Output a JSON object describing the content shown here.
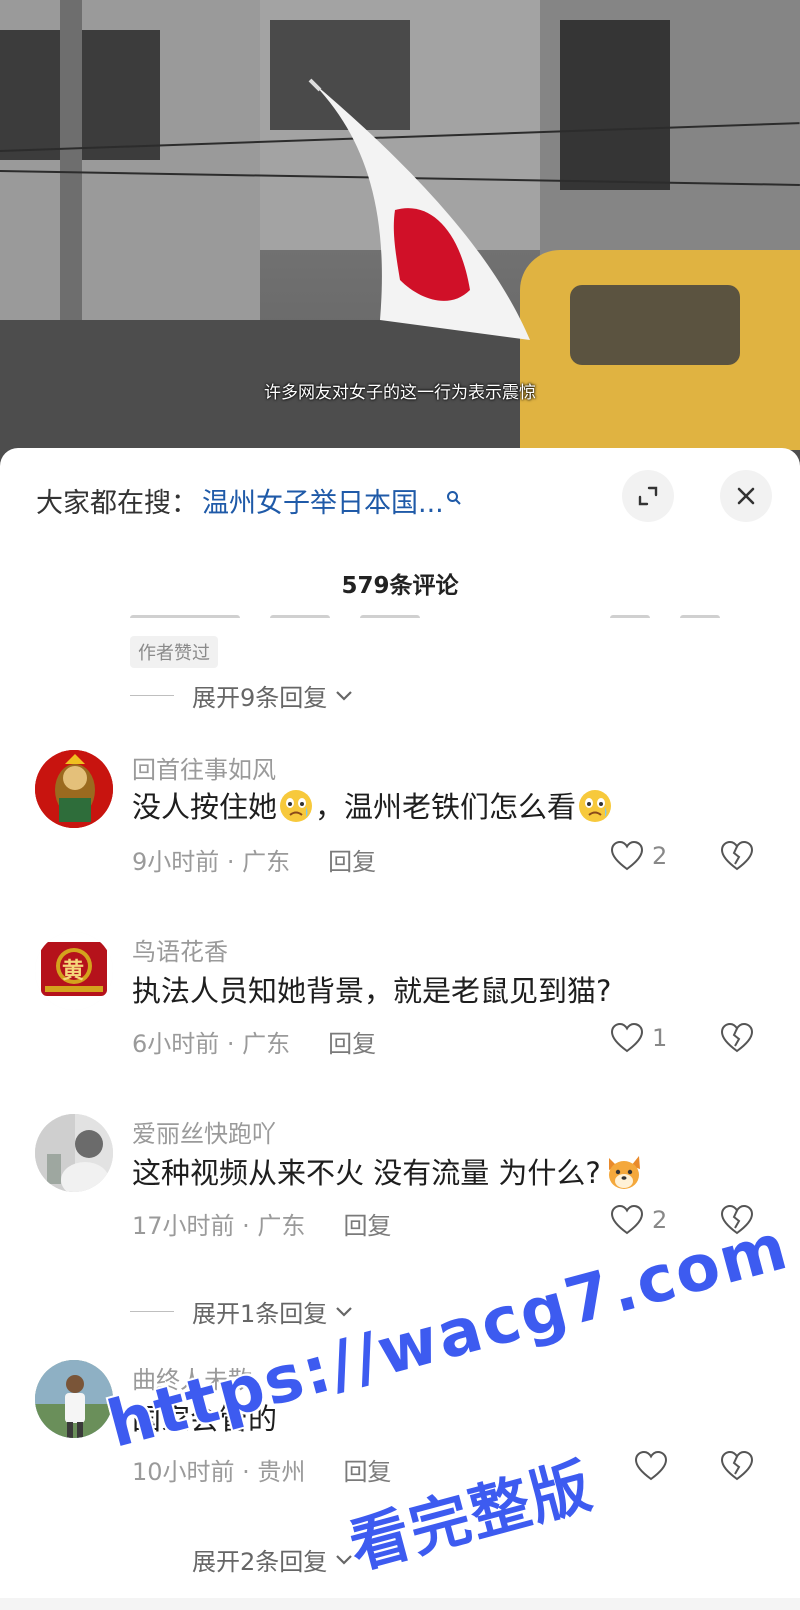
{
  "video": {
    "subtitle": "许多网友对女子的这一行为表示震惊"
  },
  "sheet": {
    "search_prefix": "大家都在搜：",
    "search_link": "温州女子举日本国...",
    "comment_count_title": "579条评论",
    "liked_by_author_tag": "作者赞过",
    "expand_top": "展开9条回复"
  },
  "comments": [
    {
      "username": "回首往事如风",
      "text_part1": "没人按住她",
      "text_part2": "，温州老铁们怎么看",
      "time_location": "9小时前 · 广东",
      "reply_label": "回复",
      "likes": "2"
    },
    {
      "username": "鸟语花香",
      "avatar_char": "黄",
      "text": "执法人员知她背景，就是老鼠见到猫?",
      "time_location": "6小时前 · 广东",
      "reply_label": "回复",
      "likes": "1"
    },
    {
      "username": "爱丽丝快跑吖",
      "text": "这种视频从来不火 没有流量 为什么?",
      "time_location": "17小时前 · 广东",
      "reply_label": "回复",
      "likes": "2",
      "expand": "展开1条回复"
    },
    {
      "username": "曲终人未散",
      "text": "国家会管的",
      "time_location": "10小时前 · 贵州",
      "reply_label": "回复",
      "likes": "",
      "expand": "展开2条回复"
    }
  ],
  "watermark": {
    "line1": "https://wacg7.com",
    "line2": "看完整版"
  }
}
